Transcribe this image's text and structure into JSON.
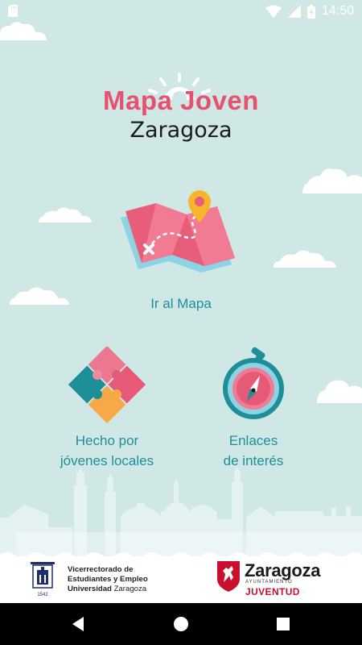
{
  "status_bar": {
    "time": "14:50",
    "icons": [
      "sd-card-icon",
      "wifi-icon",
      "signal-icon",
      "battery-charging-icon"
    ]
  },
  "logo": {
    "line1": "Mapa Joven",
    "line2": "Zaragoza"
  },
  "menu": {
    "map": {
      "label": "Ir al Mapa",
      "icon": "map-icon"
    },
    "made_by_youth": {
      "label_line1": "Hecho por",
      "label_line2": "jóvenes locales",
      "icon": "puzzle-icon"
    },
    "links": {
      "label_line1": "Enlaces",
      "label_line2": "de interés",
      "icon": "compass-icon"
    }
  },
  "footer": {
    "university": {
      "line1": "Vicerrectorado de",
      "line2": "Estudiantes y Empleo",
      "line3_bold": "Universidad",
      "line3_rest": " Zaragoza",
      "seal_year": "1542"
    },
    "city": {
      "name": "Zaragoza",
      "sub": "AYUNTAMIENTO",
      "dept": "JUVENTUD"
    }
  },
  "colors": {
    "background": "#cfe8e6",
    "title_pink": "#e6516e",
    "label_teal": "#1d8f98",
    "juventud_red": "#c8102e"
  },
  "nav_bar": {
    "buttons": [
      "back-icon",
      "home-icon",
      "recents-icon"
    ]
  }
}
